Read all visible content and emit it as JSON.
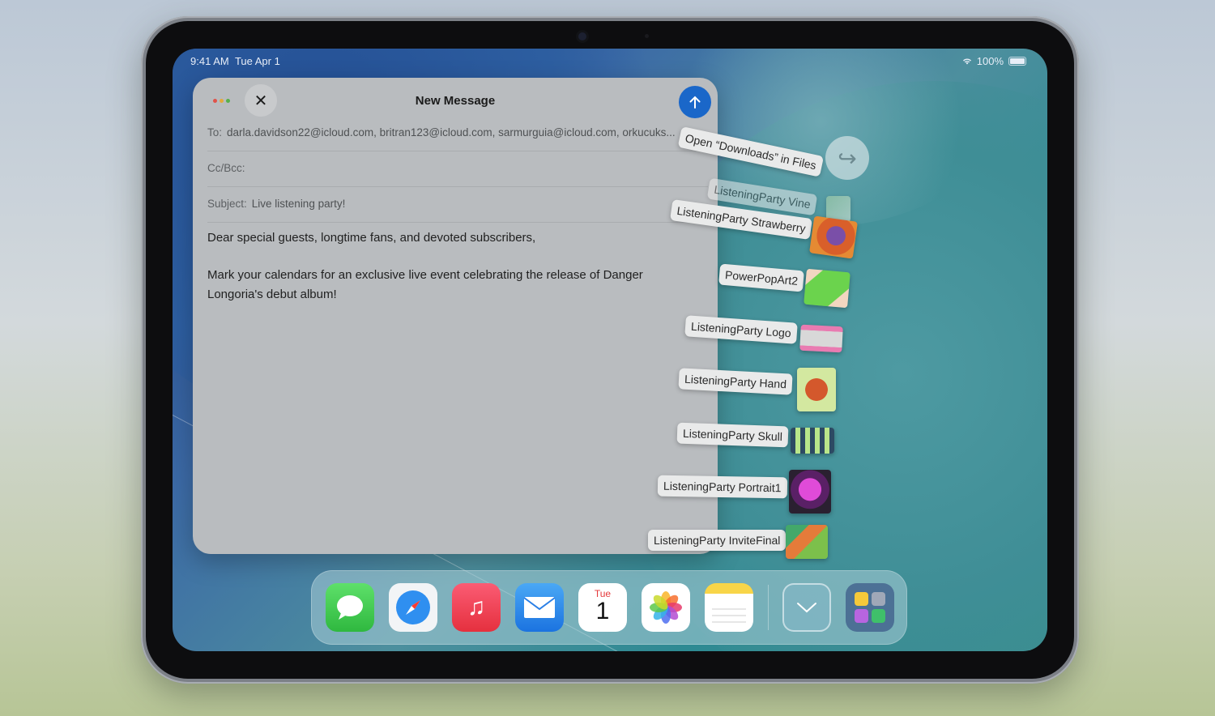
{
  "status": {
    "time": "9:41 AM",
    "date": "Tue Apr 1",
    "battery": "100%"
  },
  "mail": {
    "title": "New Message",
    "to_label": "To:",
    "to_value": "darla.davidson22@icloud.com, britran123@icloud.com, sarmurguia@icloud.com, orkucuks...",
    "cc_label": "Cc/Bcc:",
    "subject_label": "Subject:",
    "subject_value": "Live listening party!",
    "body_p1": "Dear special guests, longtime fans, and devoted subscribers,",
    "body_p2": "Mark your calendars for an exclusive live event celebrating the release of Danger Longoria's debut album!"
  },
  "drag": {
    "open_downloads": "Open “Downloads” in Files",
    "items": [
      "ListeningParty Vine",
      "ListeningParty Strawberry",
      "PowerPopArt2",
      "ListeningParty Logo",
      "ListeningParty Hand",
      "ListeningParty Skull",
      "ListeningParty Portrait1",
      "ListeningParty InviteFinal"
    ]
  },
  "dock": {
    "apps": [
      "Messages",
      "Safari",
      "Music",
      "Mail",
      "Calendar",
      "Photos",
      "Notes",
      "Downloads",
      "App Library"
    ],
    "calendar_day": "Tue",
    "calendar_date": "1"
  }
}
